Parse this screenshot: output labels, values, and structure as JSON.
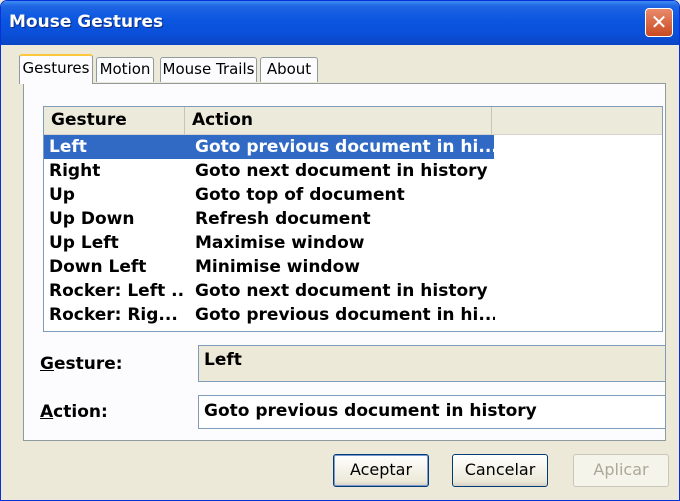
{
  "window": {
    "title": "Mouse Gestures",
    "close_glyph": "✕"
  },
  "tabs": [
    {
      "label": "Gestures",
      "active": true
    },
    {
      "label": "Motion",
      "active": false
    },
    {
      "label": "Mouse Trails",
      "active": false
    },
    {
      "label": "About",
      "active": false
    }
  ],
  "list": {
    "columns": [
      "Gesture",
      "Action"
    ],
    "rows": [
      {
        "gesture": "Left",
        "action": "Goto previous document in hi...",
        "selected": true
      },
      {
        "gesture": "Right",
        "action": "Goto next document in history"
      },
      {
        "gesture": "Up",
        "action": "Goto top of document"
      },
      {
        "gesture": "Up Down",
        "action": "Refresh document"
      },
      {
        "gesture": "Up Left",
        "action": "Maximise window"
      },
      {
        "gesture": "Down Left",
        "action": "Minimise window"
      },
      {
        "gesture": "Rocker: Left ...",
        "action": "Goto next document in history"
      },
      {
        "gesture": "Rocker: Rig...",
        "action": "Goto previous document in hi..."
      }
    ]
  },
  "fields": {
    "gesture_label_first": "G",
    "gesture_label_rest": "esture:",
    "gesture_value": "Left",
    "action_label_first": "A",
    "action_label_rest": "ction:",
    "action_value": "Goto previous document in history"
  },
  "buttons": {
    "ok": "Aceptar",
    "cancel": "Cancelar",
    "apply": "Aplicar"
  },
  "colors": {
    "selection": "#316ac5",
    "titlebar": "#0a55e0"
  }
}
